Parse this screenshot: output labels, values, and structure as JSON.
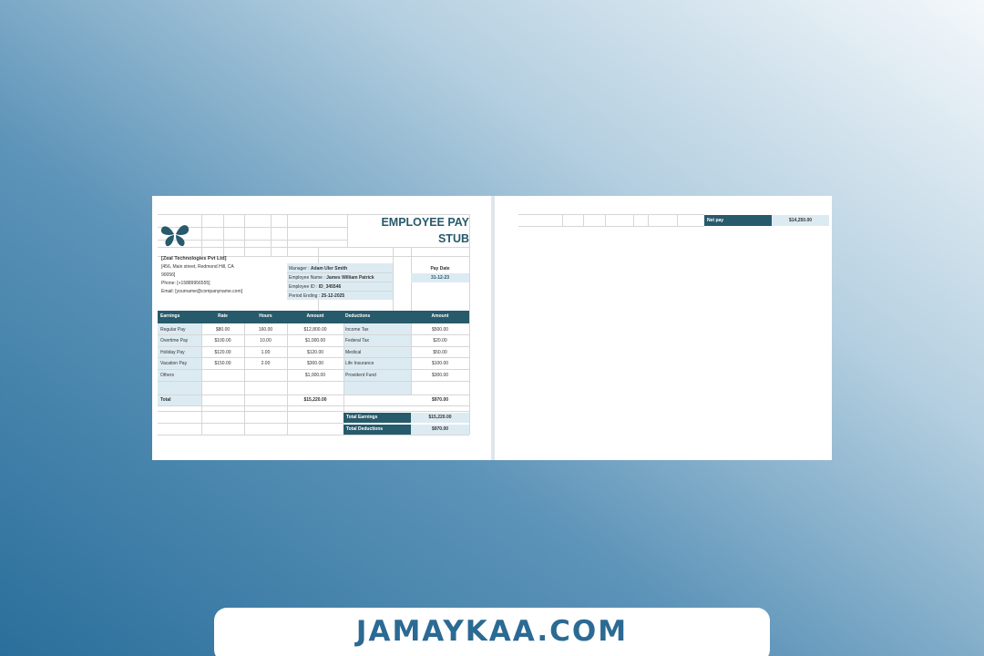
{
  "document": {
    "title": "EMPLOYEE PAY STUB",
    "title_line1": "EMPLOYEE PAY",
    "title_line2": "STUB",
    "company": {
      "name": "[Zeal Technologies Pvt Ltd]",
      "address_line1": "[456, Main street, Redmond Hill, CA",
      "address_line2": "90056]",
      "phone": "Phone: [+15889956555]",
      "email": "Email: [yourname@companyname.com]"
    },
    "employee": {
      "manager_label": "Manager :",
      "manager_value": "Adam Uler Smith",
      "name_label": "Employee Name :",
      "name_value": "James William Patrick",
      "id_label": "Employee ID :",
      "id_value": "ID_345546",
      "period_label": "Period Ending :",
      "period_value": "25-12-2025"
    },
    "pay_date": {
      "label": "Pay Date",
      "value": "31-12-23"
    },
    "earnings_headers": [
      "Earnings",
      "Rate",
      "Hours",
      "Amount"
    ],
    "deductions_headers": [
      "Deductions",
      "Amount"
    ],
    "earnings": [
      {
        "name": "Regular Pay",
        "rate": "$80.00",
        "hours": "160.00",
        "amount": "$12,800.00"
      },
      {
        "name": "Overtime Pay",
        "rate": "$100.00",
        "hours": "10.00",
        "amount": "$1,000.00"
      },
      {
        "name": "Holiday Pay",
        "rate": "$120.00",
        "hours": "1.00",
        "amount": "$120.00"
      },
      {
        "name": "Vacation Pay",
        "rate": "$150.00",
        "hours": "2.00",
        "amount": "$300.00"
      },
      {
        "name": "Others",
        "rate": "",
        "hours": "",
        "amount": "$1,000.00"
      }
    ],
    "deductions": [
      {
        "name": "Income Tax",
        "amount": "$500.00"
      },
      {
        "name": "Federal Tax",
        "amount": "$20.00"
      },
      {
        "name": "Medical",
        "amount": "$50.00"
      },
      {
        "name": "Life Insurance",
        "amount": "$100.00"
      },
      {
        "name": "Provident Fund",
        "amount": "$300.00"
      }
    ],
    "total": {
      "label": "Total",
      "earnings": "$15,220.00",
      "deductions": "$970.00"
    },
    "summary": {
      "total_earnings_label": "Total Earnings",
      "total_earnings_value": "$15,220.00",
      "total_deductions_label": "Total Deductions",
      "total_deductions_value": "$970.00"
    },
    "net_pay": {
      "label": "Net pay",
      "value": "$14,250.00"
    }
  },
  "brand": {
    "text": "JAMAYKAA.COM"
  },
  "colors": {
    "header_teal": "#275a6b",
    "light_cell": "#dcebf2",
    "brand_text": "#2b6a93"
  }
}
